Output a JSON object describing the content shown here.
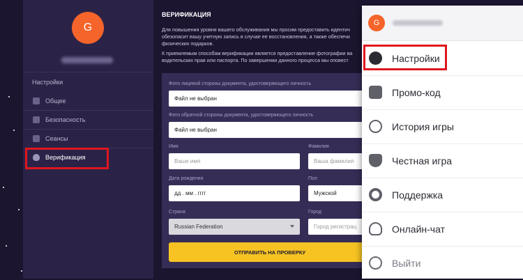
{
  "sidebar": {
    "avatar_letter": "G",
    "heading": "Настройки",
    "items": [
      {
        "label": "Общее",
        "icon": "user-icon"
      },
      {
        "label": "Безопасность",
        "icon": "shield-icon"
      },
      {
        "label": "Сеансы",
        "icon": "devices-icon"
      },
      {
        "label": "Верификация",
        "icon": "verification-shield-icon"
      }
    ]
  },
  "main": {
    "title": "ВЕРИФИКАЦИЯ",
    "paragraph1": "Для повышения уровня вашего обслуживания мы просим предоставить идентич обезопасит вашу учетную запись в случае ее восстановления, а также обеспечи физических подарков.",
    "paragraph2": "К приемлемым способам верификации является предоставление фотографии ва водительских прав или паспорта. По завершении данного процесса мы оповест",
    "form": {
      "front_label": "Фото лицевой стороны документа, удостоверяющего личность",
      "front_value": "Файл не выбран",
      "back_label": "Фото обратной стороны документа, удостоверяющего личность",
      "back_value": "Файл не выбран",
      "name_label": "Имя",
      "name_placeholder": "Ваше имя",
      "surname_label": "Фамилия",
      "surname_placeholder": "Ваша фамилия",
      "dob_label": "Дата рождения",
      "dob_value": "дд . мм . гггг",
      "gender_label": "Пол",
      "gender_value": "Мужской",
      "country_label": "Страна",
      "country_value": "Russian Federation",
      "city_label": "Город",
      "city_placeholder": "Город регистрац",
      "submit_label": "ОТПРАВИТЬ НА ПРОВЕРКУ"
    }
  },
  "menu": {
    "avatar_letter": "G",
    "items": [
      {
        "label": "Настройки",
        "icon": "gear-icon"
      },
      {
        "label": "Промо-код",
        "icon": "gift-icon"
      },
      {
        "label": "История игры",
        "icon": "clock-icon"
      },
      {
        "label": "Честная игра",
        "icon": "fair-play-icon"
      },
      {
        "label": "Поддержка",
        "icon": "lifebuoy-icon"
      },
      {
        "label": "Онлайн-чат",
        "icon": "headset-icon"
      },
      {
        "label": "Выйти",
        "icon": "logout-icon"
      }
    ]
  },
  "colors": {
    "accent": "#f6c323",
    "avatar": "#f5642a",
    "highlight": "#e0161e",
    "panel": "#2b2347"
  }
}
